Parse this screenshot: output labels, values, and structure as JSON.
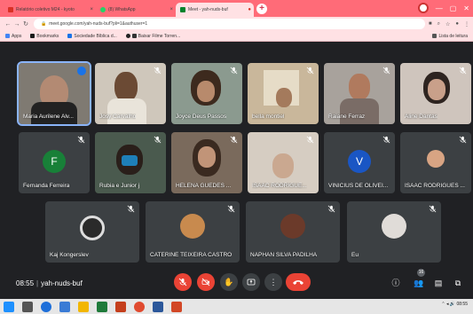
{
  "browser": {
    "tabs": [
      {
        "label": "Relatório coletivo M24 - kyoto",
        "active": false
      },
      {
        "label": "(8) WhatsApp",
        "active": false
      },
      {
        "label": "Meet - yah-nuds-buf",
        "active": true
      }
    ],
    "url": "meet.google.com/yah-nuds-buf?pli=1&authuser=1",
    "bookmarks": [
      "Apps",
      "Bookmarks",
      "Sociedade Bíblica d...",
      "Baixar Filme Torren..."
    ],
    "reading_list": "Lista de leitura"
  },
  "meet": {
    "row1": [
      {
        "name": "Maria Aurilene Alv...",
        "speaking": true
      },
      {
        "name": "Josy Carvalho"
      },
      {
        "name": "Joyce Deus Passos"
      },
      {
        "name": "bella montiel"
      },
      {
        "name": "Raiane Ferraz"
      },
      {
        "name": "Aline Dantas"
      }
    ],
    "row2": [
      {
        "name": "Fernanda Ferreira",
        "avatar_letter": "F",
        "avatar_color": "#188038"
      },
      {
        "name": "Rubia e Junior j"
      },
      {
        "name": "HELENA GUEDES ..."
      },
      {
        "name": "ISAAC RODRIGUE..."
      },
      {
        "name": "VINICIUS DE OLIVEI...",
        "avatar_letter": "V",
        "avatar_color": "#1a56c4"
      },
      {
        "name": "ISAAC RODRIGUES ..."
      }
    ],
    "row3": [
      {
        "name": "Kaj Kongerslev"
      },
      {
        "name": "CATERINE TEIXEIRA CASTRO"
      },
      {
        "name": "NAPHAN SILVA PADILHA"
      },
      {
        "name": "Eu"
      }
    ],
    "time": "08:55",
    "meeting_code": "yah-nuds-buf",
    "people_count": "16",
    "controls": [
      "mic-off",
      "camera-off",
      "raise-hand",
      "present",
      "more",
      "end-call"
    ],
    "colors": {
      "background": "#202124",
      "tile": "#3c4043",
      "danger": "#ea4335",
      "accent": "#8ab4f8"
    }
  },
  "taskbar": {
    "clock": "08:55"
  }
}
